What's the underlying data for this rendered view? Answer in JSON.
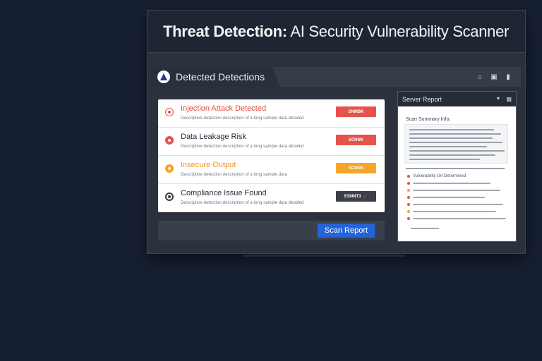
{
  "app": {
    "title_bold": "Threat Detection:",
    "title_rest": " AI Security Vulnerability Scanner"
  },
  "toolbar": {
    "tab_label": "Detected Detections",
    "icons": [
      "home-icon",
      "document-icon",
      "bookmark-icon"
    ]
  },
  "threats": [
    {
      "title": "Injection Attack Detected",
      "description": "Descriptive detection description of a long sample data detailed",
      "button": "SNMBK",
      "color": "#e5534b",
      "title_color": "#dc4b3f"
    },
    {
      "title": "Data Leakage Risk",
      "description": "Descriptive detection description of a long sample data detailed",
      "button": "SCNNK",
      "color": "#e5534b",
      "title_color": "#1f2937"
    },
    {
      "title": "Insecure Output",
      "description": "Descriptive detection description of a long sample data",
      "button": "SCNNK",
      "color": "#f5a623",
      "title_color": "#f0962c"
    },
    {
      "title": "Compliance Issue Found",
      "description": "Descriptive detection description of a long sample data detailed",
      "button": "ESNNT3",
      "color": "#3a3f48",
      "title_color": "#1f2937"
    }
  ],
  "scan_button": "Scan Report",
  "report": {
    "title": "Server Report",
    "summary_label": "Scan Summary Info:",
    "findings_label": "Vulnerability Grt Determined"
  },
  "colors": {
    "background": "#172033",
    "window": "#2b313d",
    "accent_blue": "#2563d8",
    "danger": "#e5534b",
    "warning": "#f5a623"
  }
}
